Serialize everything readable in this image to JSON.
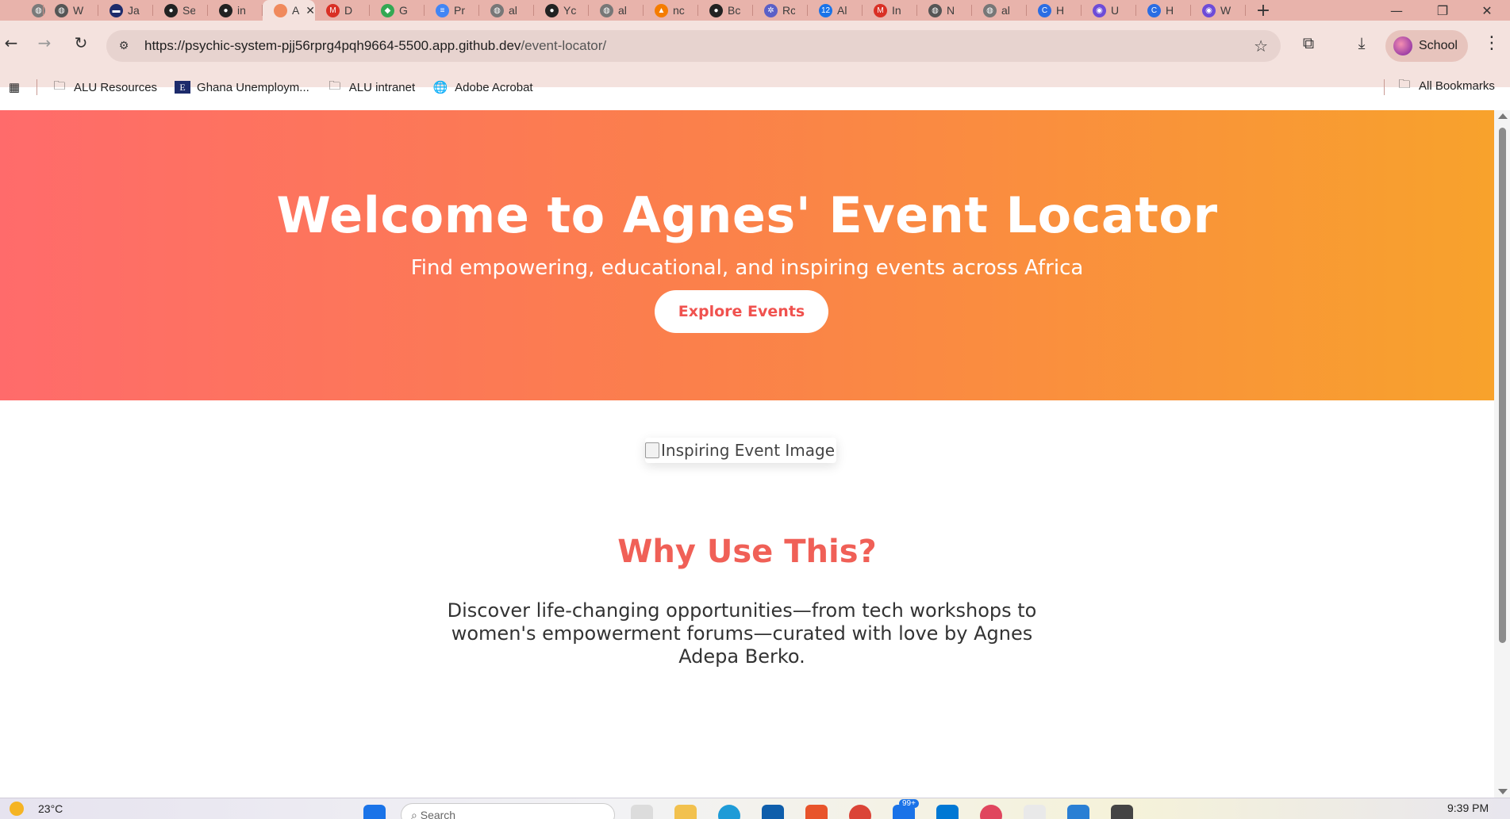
{
  "browser": {
    "tabs": [
      {
        "title": "",
        "color": "#7a7a7a",
        "glyph": "◍"
      },
      {
        "title": "W",
        "color": "#555",
        "glyph": "◍"
      },
      {
        "title": "Ja",
        "color": "#1d2b6b",
        "glyph": "▬"
      },
      {
        "title": "Se",
        "color": "#222",
        "glyph": "●"
      },
      {
        "title": "in",
        "color": "#222",
        "glyph": "●"
      },
      {
        "title": "A",
        "color": "#f08a5d",
        "glyph": "",
        "active": true
      },
      {
        "title": "D",
        "color": "#d93025",
        "glyph": "M"
      },
      {
        "title": "G",
        "color": "#34a853",
        "glyph": "◆"
      },
      {
        "title": "Pr",
        "color": "#4285f4",
        "glyph": "≡"
      },
      {
        "title": "al",
        "color": "#777",
        "glyph": "◍"
      },
      {
        "title": "Yc",
        "color": "#222",
        "glyph": "●"
      },
      {
        "title": "al",
        "color": "#777",
        "glyph": "◍"
      },
      {
        "title": "nc",
        "color": "#f57c00",
        "glyph": "▲"
      },
      {
        "title": "Bc",
        "color": "#222",
        "glyph": "●"
      },
      {
        "title": "Rc",
        "color": "#5b5fc7",
        "glyph": "✲"
      },
      {
        "title": "Al",
        "color": "#1a73e8",
        "glyph": "12"
      },
      {
        "title": "In",
        "color": "#d93025",
        "glyph": "M"
      },
      {
        "title": "N",
        "color": "#555",
        "glyph": "◍"
      },
      {
        "title": "al",
        "color": "#777",
        "glyph": "◍"
      },
      {
        "title": "H",
        "color": "#2b6de3",
        "glyph": "C"
      },
      {
        "title": "U",
        "color": "#6d4bd8",
        "glyph": "◉"
      },
      {
        "title": "H",
        "color": "#2b6de3",
        "glyph": "C"
      },
      {
        "title": "W",
        "color": "#6d4bd8",
        "glyph": "◉"
      }
    ],
    "new_tab": "+",
    "window_controls": {
      "minimize": "—",
      "restore": "❐",
      "close": "✕"
    },
    "url_host": "https://psychic-system-pjj56rprg4pqh9664-5500.app.github.dev",
    "url_path": "/event-locator/",
    "profile_label": "School",
    "bookmarks": [
      {
        "label": "ALU Resources",
        "icon": "folder-icon"
      },
      {
        "label": "Ghana Unemploym...",
        "icon": "e-icon"
      },
      {
        "label": "ALU intranet",
        "icon": "folder-icon"
      },
      {
        "label": "Adobe Acrobat",
        "icon": "globe-icon"
      }
    ],
    "all_bookmarks": "All Bookmarks"
  },
  "page": {
    "hero_title": "Welcome to Agnes' Event Locator",
    "hero_subtitle": "Find empowering, educational, and inspiring events across Africa",
    "cta_label": "Explore Events",
    "image_alt": "Inspiring Event Image",
    "why_title": "Why Use This?",
    "why_text": "Discover life-changing opportunities—from tech workshops to women's empowerment forums—curated with love by Agnes Adepa Berko.",
    "colors": {
      "gradient_start": "#ff6b6b",
      "gradient_end": "#f8a22c",
      "accent": "#f06057"
    }
  },
  "taskbar": {
    "temperature": "23°C",
    "search_placeholder": "Search",
    "badge": "99+",
    "time": "9:39 PM"
  }
}
